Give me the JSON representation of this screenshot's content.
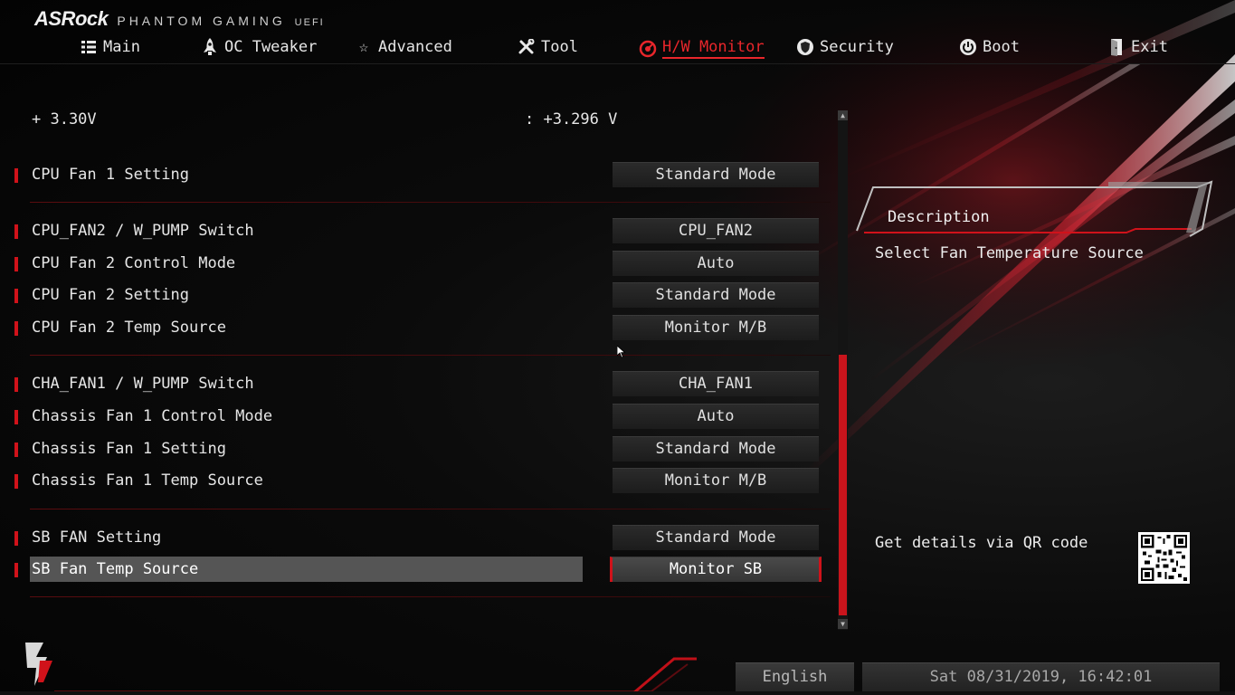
{
  "brand": {
    "logo": "ASRock",
    "subtitle": "PHANTOM GAMING",
    "uefi": "UEFI"
  },
  "nav": [
    {
      "label": "Main",
      "icon": "list-icon",
      "active": false
    },
    {
      "label": "OC Tweaker",
      "icon": "rocket-icon",
      "active": false
    },
    {
      "label": "Advanced",
      "icon": "star-icon",
      "active": false
    },
    {
      "label": "Tool",
      "icon": "tools-icon",
      "active": false
    },
    {
      "label": "H/W Monitor",
      "icon": "monitor-gauge-icon",
      "active": true
    },
    {
      "label": "Security",
      "icon": "shield-icon",
      "active": false
    },
    {
      "label": "Boot",
      "icon": "power-icon",
      "active": false
    },
    {
      "label": "Exit",
      "icon": "exit-door-icon",
      "active": false
    }
  ],
  "readings": [
    {
      "label": "+ 3.30V",
      "value": ": +3.296 V"
    }
  ],
  "settings": [
    {
      "label": "CPU Fan 1 Setting",
      "value": "Standard Mode"
    },
    {
      "label": "CPU_FAN2 / W_PUMP Switch",
      "value": "CPU_FAN2"
    },
    {
      "label": "CPU Fan 2 Control Mode",
      "value": "Auto"
    },
    {
      "label": "CPU Fan 2 Setting",
      "value": "Standard Mode"
    },
    {
      "label": "CPU Fan 2 Temp Source",
      "value": "Monitor M/B"
    },
    {
      "label": "CHA_FAN1 / W_PUMP Switch",
      "value": "CHA_FAN1"
    },
    {
      "label": "Chassis Fan 1 Control Mode",
      "value": "Auto"
    },
    {
      "label": "Chassis Fan 1 Setting",
      "value": "Standard Mode"
    },
    {
      "label": "Chassis Fan 1 Temp Source",
      "value": "Monitor M/B"
    },
    {
      "label": "SB FAN Setting",
      "value": "Standard Mode"
    },
    {
      "label": "SB Fan Temp Source",
      "value": "Monitor SB"
    }
  ],
  "description": {
    "title": "Description",
    "text": "Select Fan Temperature Source",
    "qr_text": "Get details via QR code"
  },
  "footer": {
    "language": "English",
    "datetime": "Sat 08/31/2019, 16:42:01"
  },
  "colors": {
    "accent": "#d0121a",
    "active_tab": "#e8262b",
    "scroll_thumb": "#c9141c"
  }
}
